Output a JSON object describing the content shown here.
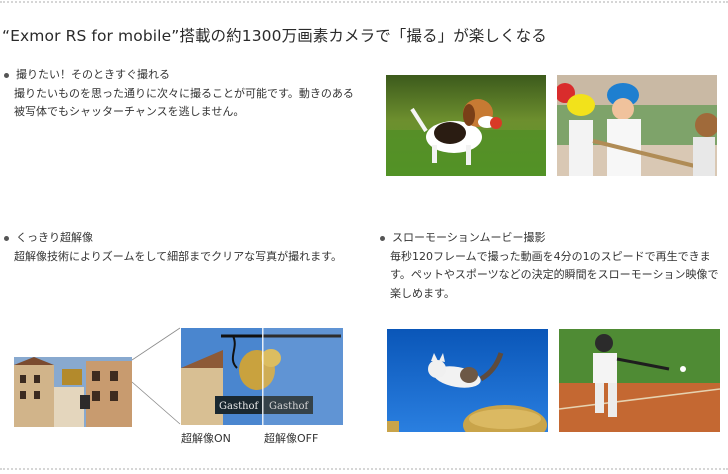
{
  "title": "“Exmor RS for mobile”搭載の約1300万画素カメラで「撮る」が楽しくなる",
  "features": [
    {
      "heading": "撮りたい！そのときすぐ撮れる",
      "body": "撮りたいものを思った通りに次々に撮ることが可能です。動きのある被写体でもシャッターチャンスを逃しません。"
    },
    {
      "heading": "くっきり超解像",
      "body": "超解像技術によりズームをして細部までクリアな写真が撮れます。"
    },
    {
      "heading": "スローモーションムービー撮影",
      "body": "毎秒120フレームで撮った動画を4分の1のスピードで再生できます。ペットやスポーツなどの決定的瞬間をスローモーション映像で楽しめます。"
    }
  ],
  "images": {
    "dog": "beagle puppy running on grass with red ball",
    "kids": "children playing tug of war",
    "town": "old town street with hanging shop sign",
    "sign_zoom": "zoomed hanging shop sign",
    "cat": "cat jumping off hay bale",
    "baseball": "baseball batter swinging"
  },
  "captions": {
    "on": "超解像ON",
    "off": "超解像OFF"
  },
  "colors": {
    "text": "#333333",
    "dotted_rule": "#d6d6d6"
  }
}
